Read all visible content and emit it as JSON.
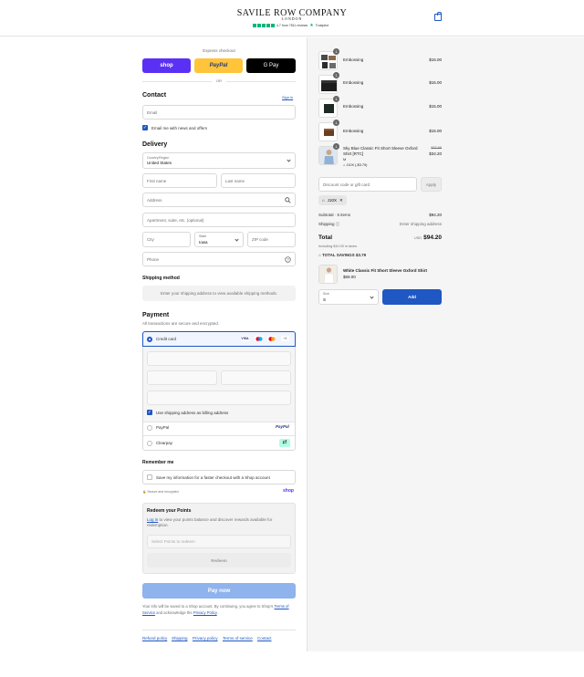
{
  "header": {
    "brand": "SAVILE ROW COMPANY",
    "brand_sub": "LONDON",
    "rating_text": "4.7 from 7811 reviews",
    "trustpilot": "Trustpilot",
    "accent": "#1f57c3"
  },
  "express": {
    "title": "Express checkout",
    "shop": "shop",
    "paypal": "PayPal",
    "gpay": "G Pay",
    "or": "OR"
  },
  "contact": {
    "heading": "Contact",
    "sign_in": "Sign in",
    "email_placeholder": "Email",
    "newsletter": "Email me with news and offers"
  },
  "delivery": {
    "heading": "Delivery",
    "country_label": "Country/Region",
    "country_value": "United States",
    "first_name": "First name",
    "last_name": "Last name",
    "address": "Address",
    "apartment": "Apartment, suite, etc. (optional)",
    "city": "City",
    "state_label": "State",
    "state_value": "Iowa",
    "zip": "ZIP code",
    "phone": "Phone"
  },
  "shipping": {
    "heading": "Shipping method",
    "placeholder": "Enter your shipping address to view available shipping methods."
  },
  "payment": {
    "heading": "Payment",
    "subtitle": "All transactions are secure and encrypted.",
    "credit_card": "Credit card",
    "cards": [
      "VISA",
      "MC",
      "MC",
      "+4"
    ],
    "billing_same": "Use shipping address as billing address",
    "paypal": "PayPal",
    "paypal_logo": "PayPal",
    "clearpay": "Clearpay"
  },
  "remember": {
    "heading": "Remember me",
    "save_info": "Save my information for a faster checkout with a Shop account",
    "secure": "Secure and encrypted",
    "shop_logo": "shop"
  },
  "points": {
    "heading": "Redeem your Points",
    "login": "Log in",
    "text_rest": " to view your points balance and discover rewards available for redemption.",
    "select_placeholder": "Select Points to redeem",
    "redeem": "Redeem"
  },
  "pay": {
    "label": "Pay now",
    "notice_1": "Your info will be saved to a Shop account. By continuing, you agree to Shop’s",
    "terms": "Terms of Service",
    "notice_2": " and acknowledge the ",
    "privacy": "Privacy Policy",
    "notice_end": "."
  },
  "footer_links": [
    "Refund policy",
    "Shipping",
    "Privacy policy",
    "Terms of service",
    "Contact"
  ],
  "summary": {
    "items": [
      {
        "qty": "1",
        "name": "Embossing",
        "price": "$15.00",
        "icon": "embossing-kit"
      },
      {
        "qty": "1",
        "name": "Embossing",
        "price": "$15.00",
        "icon": "black-box"
      },
      {
        "qty": "1",
        "name": "Embossing",
        "price": "$15.00",
        "icon": "black-wallet"
      },
      {
        "qty": "1",
        "name": "Embossing",
        "price": "$15.00",
        "icon": "brown-wallet"
      }
    ],
    "shirt": {
      "qty": "1",
      "name_1": "Sky Blue Classic Fit Short Sleeve Oxford",
      "name_2": "Shirt [RTC]",
      "size": "M",
      "discount": "J10X (-$3.79)",
      "old_price": "$37.99",
      "price": "$34.20"
    },
    "discount_placeholder": "Discount code or gift card",
    "apply": "Apply",
    "code_tag": "J10X",
    "subtotal_label": "Subtotal · 5 items",
    "subtotal": "$94.20",
    "shipping_label": "Shipping",
    "shipping_value": "Enter shipping address",
    "total_label": "Total",
    "currency": "USD",
    "total": "$94.20",
    "taxes": "Including $10.00 in taxes",
    "savings": "TOTAL SAVINGS  $3.79",
    "upsell": {
      "name": "White Classic Fit Short Sleeve Oxford Shirt",
      "price": "$69.00",
      "size_label": "Size",
      "size_value": "S",
      "add": "Add"
    }
  }
}
